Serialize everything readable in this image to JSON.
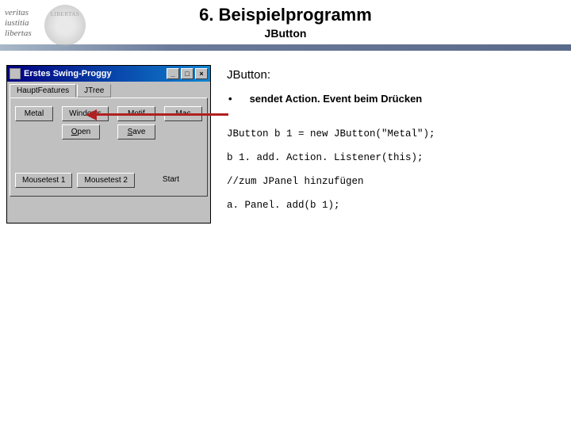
{
  "header": {
    "title": "6. Beispielprogramm",
    "subtitle": "JButton",
    "motto": [
      "veritas",
      "iustitia",
      "libertas"
    ],
    "seal_text": "LIBERTAS"
  },
  "window": {
    "title": "Erstes Swing-Proggy",
    "controls": {
      "minimize": "_",
      "maximize": "□",
      "close": "×"
    },
    "tab_active": "HauptFeatures",
    "tab_inactive": "JTree",
    "row1": [
      "Metal",
      "Windows",
      "Motif",
      "Mac"
    ],
    "row2": [
      "Open",
      "Save"
    ],
    "row2_mnemonic": [
      "O",
      "S"
    ],
    "row3": [
      "Mousetest 1",
      "Mousetest 2",
      "Start"
    ]
  },
  "section": {
    "heading": "JButton:",
    "bullet_marker": "•",
    "bullet_text": "sendet Action. Event beim Drücken",
    "code1": "JButton b 1 = new JButton(\"Metal\");",
    "code2": "b 1. add. Action. Listener(this);",
    "code3": "//zum JPanel hinzufügen",
    "code4": "a. Panel. add(b 1);"
  }
}
